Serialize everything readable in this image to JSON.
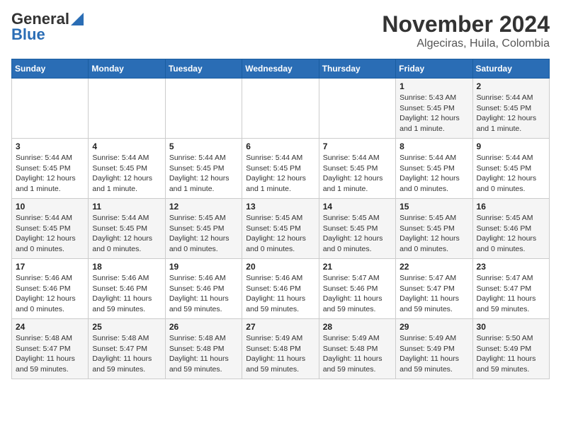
{
  "header": {
    "logo_general": "General",
    "logo_blue": "Blue",
    "month_title": "November 2024",
    "location": "Algeciras, Huila, Colombia"
  },
  "days_of_week": [
    "Sunday",
    "Monday",
    "Tuesday",
    "Wednesday",
    "Thursday",
    "Friday",
    "Saturday"
  ],
  "weeks": [
    [
      {
        "day": "",
        "info": ""
      },
      {
        "day": "",
        "info": ""
      },
      {
        "day": "",
        "info": ""
      },
      {
        "day": "",
        "info": ""
      },
      {
        "day": "",
        "info": ""
      },
      {
        "day": "1",
        "info": "Sunrise: 5:43 AM\nSunset: 5:45 PM\nDaylight: 12 hours and 1 minute."
      },
      {
        "day": "2",
        "info": "Sunrise: 5:44 AM\nSunset: 5:45 PM\nDaylight: 12 hours and 1 minute."
      }
    ],
    [
      {
        "day": "3",
        "info": "Sunrise: 5:44 AM\nSunset: 5:45 PM\nDaylight: 12 hours and 1 minute."
      },
      {
        "day": "4",
        "info": "Sunrise: 5:44 AM\nSunset: 5:45 PM\nDaylight: 12 hours and 1 minute."
      },
      {
        "day": "5",
        "info": "Sunrise: 5:44 AM\nSunset: 5:45 PM\nDaylight: 12 hours and 1 minute."
      },
      {
        "day": "6",
        "info": "Sunrise: 5:44 AM\nSunset: 5:45 PM\nDaylight: 12 hours and 1 minute."
      },
      {
        "day": "7",
        "info": "Sunrise: 5:44 AM\nSunset: 5:45 PM\nDaylight: 12 hours and 1 minute."
      },
      {
        "day": "8",
        "info": "Sunrise: 5:44 AM\nSunset: 5:45 PM\nDaylight: 12 hours and 0 minutes."
      },
      {
        "day": "9",
        "info": "Sunrise: 5:44 AM\nSunset: 5:45 PM\nDaylight: 12 hours and 0 minutes."
      }
    ],
    [
      {
        "day": "10",
        "info": "Sunrise: 5:44 AM\nSunset: 5:45 PM\nDaylight: 12 hours and 0 minutes."
      },
      {
        "day": "11",
        "info": "Sunrise: 5:44 AM\nSunset: 5:45 PM\nDaylight: 12 hours and 0 minutes."
      },
      {
        "day": "12",
        "info": "Sunrise: 5:45 AM\nSunset: 5:45 PM\nDaylight: 12 hours and 0 minutes."
      },
      {
        "day": "13",
        "info": "Sunrise: 5:45 AM\nSunset: 5:45 PM\nDaylight: 12 hours and 0 minutes."
      },
      {
        "day": "14",
        "info": "Sunrise: 5:45 AM\nSunset: 5:45 PM\nDaylight: 12 hours and 0 minutes."
      },
      {
        "day": "15",
        "info": "Sunrise: 5:45 AM\nSunset: 5:45 PM\nDaylight: 12 hours and 0 minutes."
      },
      {
        "day": "16",
        "info": "Sunrise: 5:45 AM\nSunset: 5:46 PM\nDaylight: 12 hours and 0 minutes."
      }
    ],
    [
      {
        "day": "17",
        "info": "Sunrise: 5:46 AM\nSunset: 5:46 PM\nDaylight: 12 hours and 0 minutes."
      },
      {
        "day": "18",
        "info": "Sunrise: 5:46 AM\nSunset: 5:46 PM\nDaylight: 11 hours and 59 minutes."
      },
      {
        "day": "19",
        "info": "Sunrise: 5:46 AM\nSunset: 5:46 PM\nDaylight: 11 hours and 59 minutes."
      },
      {
        "day": "20",
        "info": "Sunrise: 5:46 AM\nSunset: 5:46 PM\nDaylight: 11 hours and 59 minutes."
      },
      {
        "day": "21",
        "info": "Sunrise: 5:47 AM\nSunset: 5:46 PM\nDaylight: 11 hours and 59 minutes."
      },
      {
        "day": "22",
        "info": "Sunrise: 5:47 AM\nSunset: 5:47 PM\nDaylight: 11 hours and 59 minutes."
      },
      {
        "day": "23",
        "info": "Sunrise: 5:47 AM\nSunset: 5:47 PM\nDaylight: 11 hours and 59 minutes."
      }
    ],
    [
      {
        "day": "24",
        "info": "Sunrise: 5:48 AM\nSunset: 5:47 PM\nDaylight: 11 hours and 59 minutes."
      },
      {
        "day": "25",
        "info": "Sunrise: 5:48 AM\nSunset: 5:47 PM\nDaylight: 11 hours and 59 minutes."
      },
      {
        "day": "26",
        "info": "Sunrise: 5:48 AM\nSunset: 5:48 PM\nDaylight: 11 hours and 59 minutes."
      },
      {
        "day": "27",
        "info": "Sunrise: 5:49 AM\nSunset: 5:48 PM\nDaylight: 11 hours and 59 minutes."
      },
      {
        "day": "28",
        "info": "Sunrise: 5:49 AM\nSunset: 5:48 PM\nDaylight: 11 hours and 59 minutes."
      },
      {
        "day": "29",
        "info": "Sunrise: 5:49 AM\nSunset: 5:49 PM\nDaylight: 11 hours and 59 minutes."
      },
      {
        "day": "30",
        "info": "Sunrise: 5:50 AM\nSunset: 5:49 PM\nDaylight: 11 hours and 59 minutes."
      }
    ]
  ]
}
